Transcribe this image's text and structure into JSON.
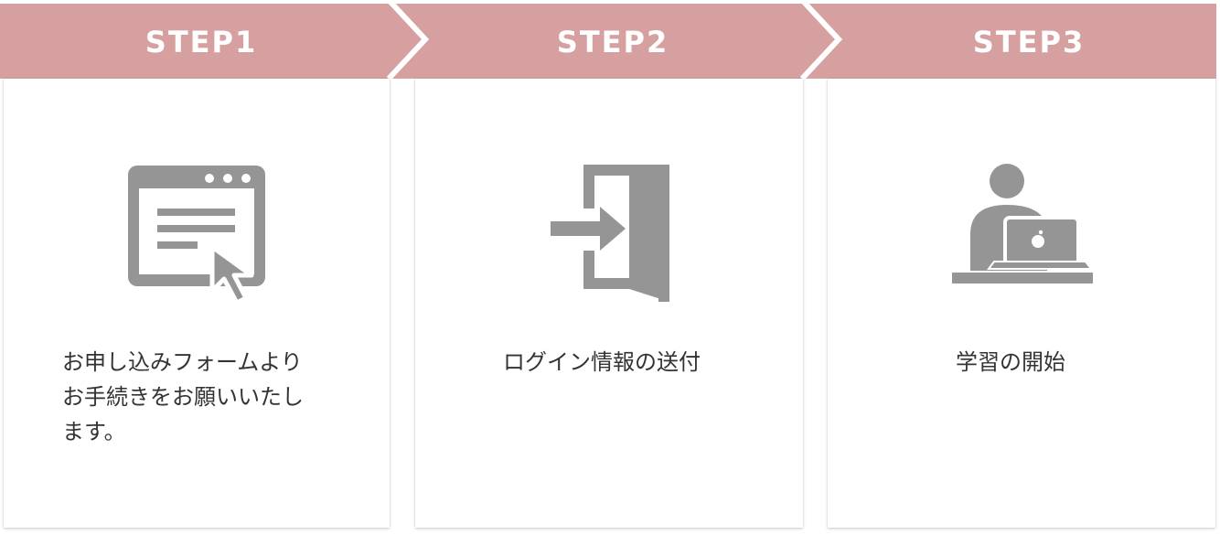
{
  "colors": {
    "banner": "#d7a0a0",
    "icon": "#959595",
    "text": "#333333",
    "card": "#ffffff"
  },
  "steps": [
    {
      "label": "STEP1",
      "icon": "browser-form-cursor-icon",
      "description": "お申し込みフォームより\nお手続きをお願いいたし\nます。"
    },
    {
      "label": "STEP2",
      "icon": "login-door-icon",
      "description": "ログイン情報の送付"
    },
    {
      "label": "STEP3",
      "icon": "person-laptop-icon",
      "description": "学習の開始"
    }
  ]
}
